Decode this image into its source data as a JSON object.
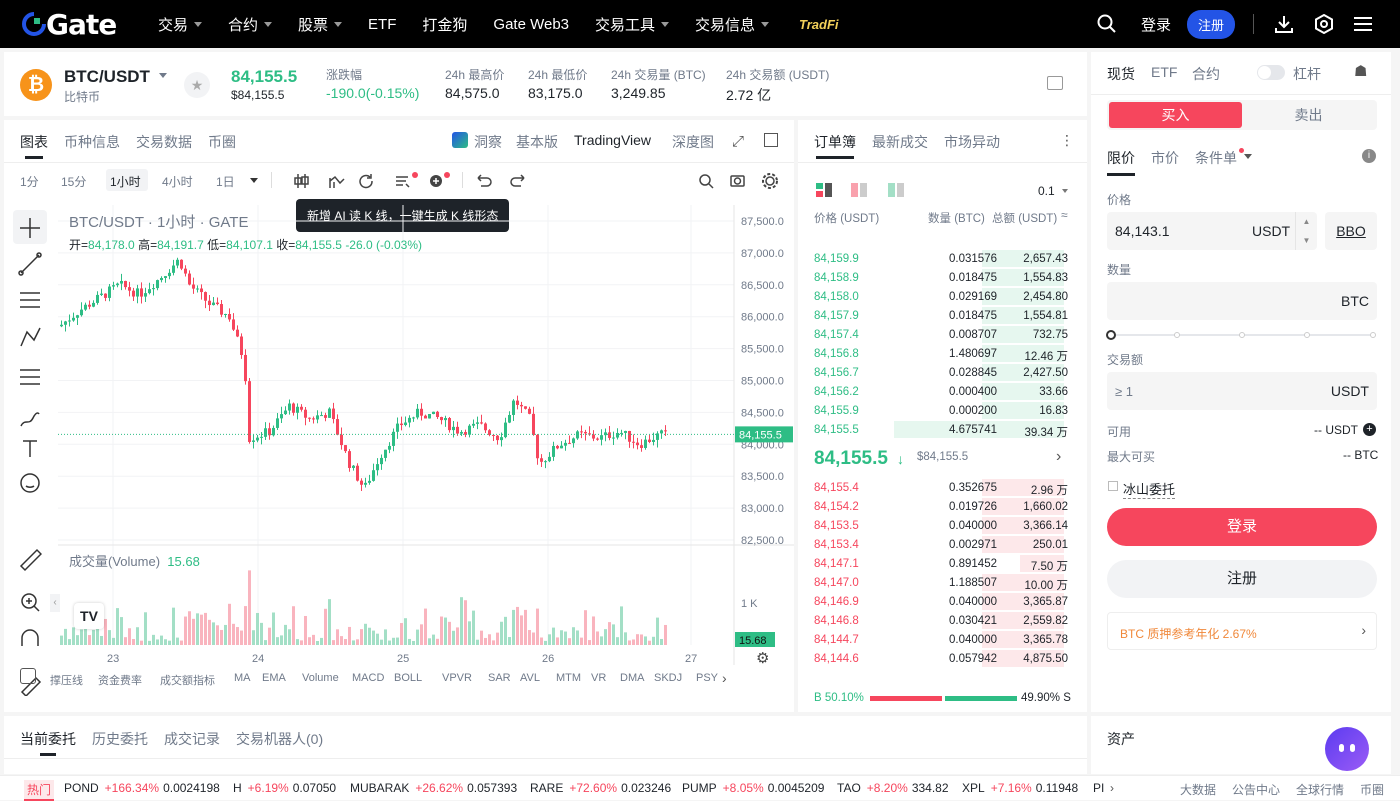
{
  "nav": {
    "logo": "Gate",
    "items": [
      "交易",
      "合约",
      "股票",
      "ETF",
      "打金狗",
      "Gate Web3",
      "交易工具",
      "交易信息"
    ],
    "tradfi": "TradFi",
    "login": "登录",
    "register": "注册"
  },
  "ticker": {
    "pair": "BTC/USDT",
    "name": "比特币",
    "price": "84,155.5",
    "price_usd": "$84,155.5",
    "change_label": "涨跌幅",
    "change": "-190.0(-0.15%)",
    "high_label": "24h 最高价",
    "high": "84,575.0",
    "low_label": "24h 最低价",
    "low": "83,175.0",
    "vol_label": "24h 交易量 (BTC)",
    "vol": "3,249.85",
    "amt_label": "24h 交易额 (USDT)",
    "amt": "2.72 亿"
  },
  "chart_tabs": [
    "图表",
    "币种信息",
    "交易数据",
    "币圈"
  ],
  "chart_views": {
    "dongjian": "洞察",
    "basic": "基本版",
    "tv": "TradingView",
    "depth": "深度图"
  },
  "intervals": [
    "1分",
    "15分",
    "1小时",
    "4小时",
    "1日"
  ],
  "tooltip": "新增 AI 读 K 线，一键生成 K 线形态",
  "legend": {
    "title": "BTC/USDT · 1小时 · GATE",
    "o_label": "开=",
    "o": "84,178.0",
    "h_label": "高=",
    "h": "84,191.7",
    "l_label": "低=",
    "l": "84,107.1",
    "c_label": "收=",
    "c": "84,155.5",
    "chg": "-26.0 (-0.03%)"
  },
  "volume": {
    "label": "成交量(Volume)",
    "value": "15.68",
    "axis": "1 K",
    "last": "15.68"
  },
  "indicators": [
    "撑压线",
    "资金费率",
    "成交额指标",
    "MA",
    "EMA",
    "Volume",
    "MACD",
    "BOLL",
    "VPVR",
    "SAR",
    "AVL",
    "MTM",
    "VR",
    "DMA",
    "SKDJ",
    "PSY"
  ],
  "chart_data": {
    "type": "candlestick",
    "y_ticks": [
      "87,500.0",
      "87,000.0",
      "86,500.0",
      "86,000.0",
      "85,500.0",
      "85,000.0",
      "84,500.0",
      "84,000.0",
      "83,500.0",
      "83,000.0",
      "82,500.0"
    ],
    "x_ticks": [
      "23",
      "24",
      "25",
      "26",
      "27"
    ],
    "last_price": "84,155.5",
    "ylim": [
      82500,
      87500
    ]
  },
  "orderbook": {
    "tabs": [
      "订单簿",
      "最新成交",
      "市场异动"
    ],
    "precision": "0.1",
    "headers": [
      "价格 (USDT)",
      "数量 (BTC)",
      "总额 (USDT)"
    ],
    "asks": [
      [
        "84,159.9",
        "0.031576",
        "2,657.43"
      ],
      [
        "84,158.9",
        "0.018475",
        "1,554.83"
      ],
      [
        "84,158.0",
        "0.029169",
        "2,454.80"
      ],
      [
        "84,157.9",
        "0.018475",
        "1,554.81"
      ],
      [
        "84,157.4",
        "0.008707",
        "732.75"
      ],
      [
        "84,156.8",
        "1.480697",
        "12.46 万"
      ],
      [
        "84,156.7",
        "0.028845",
        "2,427.50"
      ],
      [
        "84,156.2",
        "0.000400",
        "33.66"
      ],
      [
        "84,155.9",
        "0.000200",
        "16.83"
      ],
      [
        "84,155.5",
        "4.675741",
        "39.34 万"
      ]
    ],
    "mid": "84,155.5",
    "mid_usd": "$84,155.5",
    "bids": [
      [
        "84,155.4",
        "0.352675",
        "2.96 万"
      ],
      [
        "84,154.2",
        "0.019726",
        "1,660.02"
      ],
      [
        "84,153.5",
        "0.040000",
        "3,366.14"
      ],
      [
        "84,153.4",
        "0.002971",
        "250.01"
      ],
      [
        "84,147.1",
        "0.891452",
        "7.50 万"
      ],
      [
        "84,147.0",
        "1.188507",
        "10.00 万"
      ],
      [
        "84,146.9",
        "0.040000",
        "3,365.87"
      ],
      [
        "84,146.8",
        "0.030421",
        "2,559.82"
      ],
      [
        "84,144.7",
        "0.040000",
        "3,365.78"
      ],
      [
        "84,144.6",
        "0.057942",
        "4,875.50"
      ]
    ],
    "buy_ratio": "B 50.10%",
    "sell_ratio": "49.90% S"
  },
  "trade": {
    "tabs": [
      "现货",
      "ETF",
      "合约"
    ],
    "leverage": "杠杆",
    "buy": "买入",
    "sell": "卖出",
    "types": [
      "限价",
      "市价",
      "条件单"
    ],
    "price_label": "价格",
    "price": "84,143.1",
    "unit": "USDT",
    "bbo": "BBO",
    "qty_label": "数量",
    "qty_unit": "BTC",
    "amt_label": "交易额",
    "amt_ph": "≥ 1",
    "amt_unit": "USDT",
    "avail_label": "可用",
    "avail": "-- USDT",
    "maxbuy_label": "最大可买",
    "maxbuy": "-- BTC",
    "iceberg": "冰山委托",
    "login": "登录",
    "register": "注册",
    "promo": "BTC 质押参考年化 2.67%"
  },
  "orders": {
    "tabs": [
      "当前委托",
      "历史委托",
      "成交记录",
      "交易机器人(0)"
    ],
    "assets": "资产"
  },
  "footer": {
    "hot": "热门",
    "items": [
      [
        "POND",
        "+166.34%",
        "0.0024198"
      ],
      [
        "H",
        "+6.19%",
        "0.07050"
      ],
      [
        "MUBARAK",
        "+26.62%",
        "0.057393"
      ],
      [
        "RARE",
        "+72.60%",
        "0.023246"
      ],
      [
        "PUMP",
        "+8.05%",
        "0.0045209"
      ],
      [
        "TAO",
        "+8.20%",
        "334.82"
      ],
      [
        "XPL",
        "+7.16%",
        "0.11948"
      ]
    ],
    "trunc": "PI",
    "links": [
      "大数据",
      "公告中心",
      "全球行情",
      "币圈"
    ]
  }
}
